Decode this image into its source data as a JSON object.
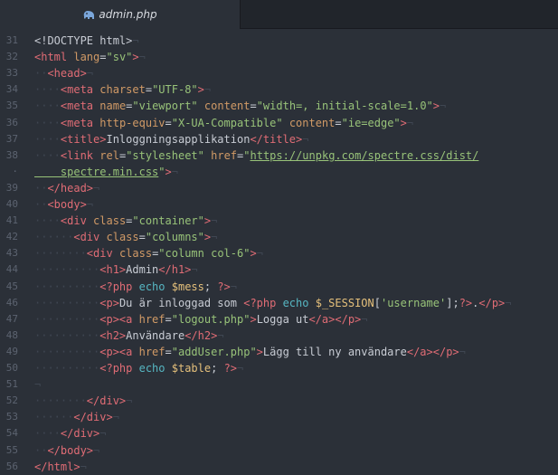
{
  "tab": {
    "filename": "admin.php",
    "icon": "elephant-icon"
  },
  "colors": {
    "tag": "#e06c75",
    "attribute": "#d19a66",
    "string": "#98c379",
    "text": "#c8ccd4",
    "php_keyword": "#56b6c2",
    "php_variable": "#e5c07b",
    "whitespace": "#3f4652",
    "gutter": "#5c6370",
    "background": "#2b3038"
  },
  "lines": [
    {
      "n": "31",
      "s": [
        [
          "t",
          "<!DOCTYPE html>"
        ],
        [
          "w",
          "¬"
        ]
      ]
    },
    {
      "n": "32",
      "s": [
        [
          "tg",
          "<html"
        ],
        [
          "t",
          " "
        ],
        [
          "at",
          "lang"
        ],
        [
          "t",
          "="
        ],
        [
          "st",
          "\"sv\""
        ],
        [
          "tg",
          ">"
        ],
        [
          "w",
          "¬"
        ]
      ]
    },
    {
      "n": "33",
      "s": [
        [
          "w",
          "··"
        ],
        [
          "tg",
          "<head>"
        ],
        [
          "w",
          "¬"
        ]
      ]
    },
    {
      "n": "34",
      "s": [
        [
          "w",
          "····"
        ],
        [
          "tg",
          "<meta"
        ],
        [
          "t",
          " "
        ],
        [
          "at",
          "charset"
        ],
        [
          "t",
          "="
        ],
        [
          "st",
          "\"UTF-8\""
        ],
        [
          "tg",
          ">"
        ],
        [
          "w",
          "¬"
        ]
      ]
    },
    {
      "n": "35",
      "s": [
        [
          "w",
          "····"
        ],
        [
          "tg",
          "<meta"
        ],
        [
          "t",
          " "
        ],
        [
          "at",
          "name"
        ],
        [
          "t",
          "="
        ],
        [
          "st",
          "\"viewport\""
        ],
        [
          "t",
          " "
        ],
        [
          "at",
          "content"
        ],
        [
          "t",
          "="
        ],
        [
          "st",
          "\"width=, initial-scale=1.0\""
        ],
        [
          "tg",
          ">"
        ],
        [
          "w",
          "¬"
        ]
      ]
    },
    {
      "n": "36",
      "s": [
        [
          "w",
          "····"
        ],
        [
          "tg",
          "<meta"
        ],
        [
          "t",
          " "
        ],
        [
          "at",
          "http-equiv"
        ],
        [
          "t",
          "="
        ],
        [
          "st",
          "\"X-UA-Compatible\""
        ],
        [
          "t",
          " "
        ],
        [
          "at",
          "content"
        ],
        [
          "t",
          "="
        ],
        [
          "st",
          "\"ie=edge\""
        ],
        [
          "tg",
          ">"
        ],
        [
          "w",
          "¬"
        ]
      ]
    },
    {
      "n": "37",
      "s": [
        [
          "w",
          "····"
        ],
        [
          "tg",
          "<title>"
        ],
        [
          "t",
          "Inloggningsapplikation"
        ],
        [
          "tg",
          "</title>"
        ],
        [
          "w",
          "¬"
        ]
      ]
    },
    {
      "n": "38",
      "s": [
        [
          "w",
          "····"
        ],
        [
          "tg",
          "<link"
        ],
        [
          "t",
          " "
        ],
        [
          "at",
          "rel"
        ],
        [
          "t",
          "="
        ],
        [
          "st",
          "\"stylesheet\""
        ],
        [
          "t",
          " "
        ],
        [
          "at",
          "href"
        ],
        [
          "t",
          "="
        ],
        [
          "st",
          "\""
        ],
        [
          "url",
          "https://unpkg.com/spectre.css/dist/"
        ]
      ]
    },
    {
      "n": "·",
      "s": [
        [
          "url",
          "    spectre.min.css"
        ],
        [
          "st",
          "\""
        ],
        [
          "tg",
          ">"
        ],
        [
          "w",
          "¬"
        ]
      ]
    },
    {
      "n": "39",
      "s": [
        [
          "w",
          "··"
        ],
        [
          "tg",
          "</head>"
        ],
        [
          "w",
          "¬"
        ]
      ]
    },
    {
      "n": "40",
      "s": [
        [
          "w",
          "··"
        ],
        [
          "tg",
          "<body>"
        ],
        [
          "w",
          "¬"
        ]
      ]
    },
    {
      "n": "41",
      "s": [
        [
          "w",
          "····"
        ],
        [
          "tg",
          "<div"
        ],
        [
          "t",
          " "
        ],
        [
          "at",
          "class"
        ],
        [
          "t",
          "="
        ],
        [
          "st",
          "\"container\""
        ],
        [
          "tg",
          ">"
        ],
        [
          "w",
          "¬"
        ]
      ]
    },
    {
      "n": "42",
      "s": [
        [
          "w",
          "······"
        ],
        [
          "tg",
          "<div"
        ],
        [
          "t",
          " "
        ],
        [
          "at",
          "class"
        ],
        [
          "t",
          "="
        ],
        [
          "st",
          "\"columns\""
        ],
        [
          "tg",
          ">"
        ],
        [
          "w",
          "¬"
        ]
      ]
    },
    {
      "n": "43",
      "s": [
        [
          "w",
          "········"
        ],
        [
          "tg",
          "<div"
        ],
        [
          "t",
          " "
        ],
        [
          "at",
          "class"
        ],
        [
          "t",
          "="
        ],
        [
          "st",
          "\"column col-6\""
        ],
        [
          "tg",
          ">"
        ],
        [
          "w",
          "¬"
        ]
      ]
    },
    {
      "n": "44",
      "s": [
        [
          "w",
          "··········"
        ],
        [
          "tg",
          "<h1>"
        ],
        [
          "t",
          "Admin"
        ],
        [
          "tg",
          "</h1>"
        ],
        [
          "w",
          "¬"
        ]
      ]
    },
    {
      "n": "45",
      "s": [
        [
          "w",
          "··········"
        ],
        [
          "ph",
          "<?php"
        ],
        [
          "t",
          " "
        ],
        [
          "kw",
          "echo"
        ],
        [
          "t",
          " "
        ],
        [
          "var",
          "$mess"
        ],
        [
          "t",
          "; "
        ],
        [
          "ph",
          "?>"
        ],
        [
          "w",
          "¬"
        ]
      ]
    },
    {
      "n": "46",
      "s": [
        [
          "w",
          "··········"
        ],
        [
          "tg",
          "<p>"
        ],
        [
          "t",
          "Du är inloggad som "
        ],
        [
          "ph",
          "<?php"
        ],
        [
          "t",
          " "
        ],
        [
          "kw",
          "echo"
        ],
        [
          "t",
          " "
        ],
        [
          "var",
          "$_SESSION"
        ],
        [
          "t",
          "["
        ],
        [
          "st",
          "'username'"
        ],
        [
          "t",
          "];"
        ],
        [
          "ph",
          "?>"
        ],
        [
          "t",
          "."
        ],
        [
          "tg",
          "</p>"
        ],
        [
          "w",
          "¬"
        ]
      ]
    },
    {
      "n": "47",
      "s": [
        [
          "w",
          "··········"
        ],
        [
          "tg",
          "<p><a"
        ],
        [
          "t",
          " "
        ],
        [
          "at",
          "href"
        ],
        [
          "t",
          "="
        ],
        [
          "st",
          "\"logout.php\""
        ],
        [
          "tg",
          ">"
        ],
        [
          "t",
          "Logga ut"
        ],
        [
          "tg",
          "</a></p>"
        ],
        [
          "w",
          "¬"
        ]
      ]
    },
    {
      "n": "48",
      "s": [
        [
          "w",
          "··········"
        ],
        [
          "tg",
          "<h2>"
        ],
        [
          "t",
          "Användare"
        ],
        [
          "tg",
          "</h2>"
        ],
        [
          "w",
          "¬"
        ]
      ]
    },
    {
      "n": "49",
      "s": [
        [
          "w",
          "··········"
        ],
        [
          "tg",
          "<p><a"
        ],
        [
          "t",
          " "
        ],
        [
          "at",
          "href"
        ],
        [
          "t",
          "="
        ],
        [
          "st",
          "\"addUser.php\""
        ],
        [
          "tg",
          ">"
        ],
        [
          "t",
          "Lägg till ny användare"
        ],
        [
          "tg",
          "</a></p>"
        ],
        [
          "w",
          "¬"
        ]
      ]
    },
    {
      "n": "50",
      "s": [
        [
          "w",
          "··········"
        ],
        [
          "ph",
          "<?php"
        ],
        [
          "t",
          " "
        ],
        [
          "kw",
          "echo"
        ],
        [
          "t",
          " "
        ],
        [
          "var",
          "$table"
        ],
        [
          "t",
          "; "
        ],
        [
          "ph",
          "?>"
        ],
        [
          "w",
          "¬"
        ]
      ]
    },
    {
      "n": "51",
      "s": [
        [
          "w",
          "¬"
        ]
      ]
    },
    {
      "n": "52",
      "s": [
        [
          "w",
          "········"
        ],
        [
          "tg",
          "</div>"
        ],
        [
          "w",
          "¬"
        ]
      ]
    },
    {
      "n": "53",
      "s": [
        [
          "w",
          "······"
        ],
        [
          "tg",
          "</div>"
        ],
        [
          "w",
          "¬"
        ]
      ]
    },
    {
      "n": "54",
      "s": [
        [
          "w",
          "····"
        ],
        [
          "tg",
          "</div>"
        ],
        [
          "w",
          "¬"
        ]
      ]
    },
    {
      "n": "55",
      "s": [
        [
          "w",
          "··"
        ],
        [
          "tg",
          "</body>"
        ],
        [
          "w",
          "¬"
        ]
      ]
    },
    {
      "n": "56",
      "s": [
        [
          "tg",
          "</html>"
        ],
        [
          "w",
          "¬"
        ]
      ]
    }
  ]
}
